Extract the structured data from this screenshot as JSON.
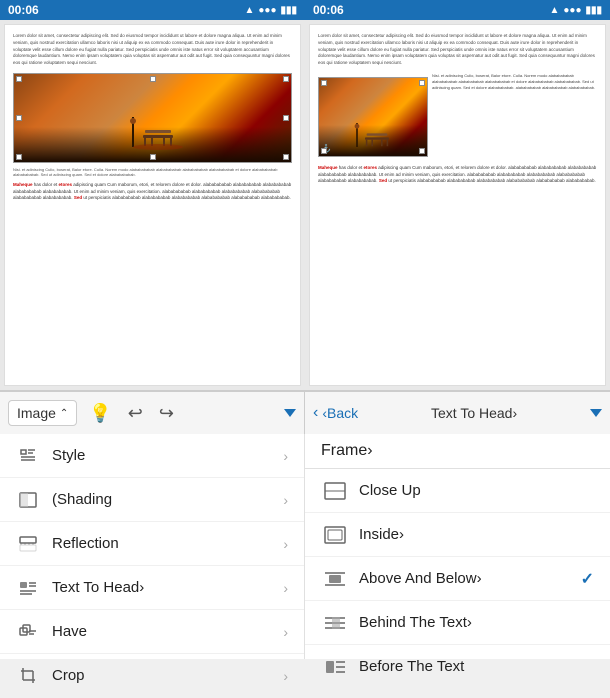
{
  "statusBars": [
    {
      "time": "00:06",
      "carrier": "Wifi",
      "battery": "battery"
    },
    {
      "time": "00:06",
      "carrier": "",
      "battery": "battery"
    }
  ],
  "toolbar": {
    "imageLabel": "Image",
    "backLabel": "‹Back",
    "textToHeadLabel": "Text To Head›",
    "dropdownArrow": "▼"
  },
  "leftPanel": {
    "header": "Frame›",
    "items": [
      {
        "icon": "style-icon",
        "label": "Style",
        "hasChevron": true
      },
      {
        "icon": "shading-icon",
        "label": "(Shading",
        "hasChevron": true
      },
      {
        "icon": "reflection-icon",
        "label": "Reflection",
        "hasChevron": true
      },
      {
        "icon": "text-to-head-icon",
        "label": "Text To Head›",
        "hasChevron": true
      },
      {
        "icon": "have-icon",
        "label": "Have",
        "hasChevron": true
      },
      {
        "icon": "crop-icon",
        "label": "Crop",
        "hasChevron": true
      }
    ]
  },
  "rightPanel": {
    "items": [
      {
        "icon": "close-up-icon",
        "label": "Close Up",
        "hasCheck": false
      },
      {
        "icon": "inside-icon",
        "label": "Inside›",
        "hasCheck": false
      },
      {
        "icon": "above-below-icon",
        "label": "Above And Below›",
        "hasCheck": true
      },
      {
        "icon": "behind-text-icon",
        "label": "Behind The Text›",
        "hasCheck": false
      },
      {
        "icon": "before-text-icon",
        "label": "Before The Text",
        "hasCheck": false
      }
    ]
  }
}
